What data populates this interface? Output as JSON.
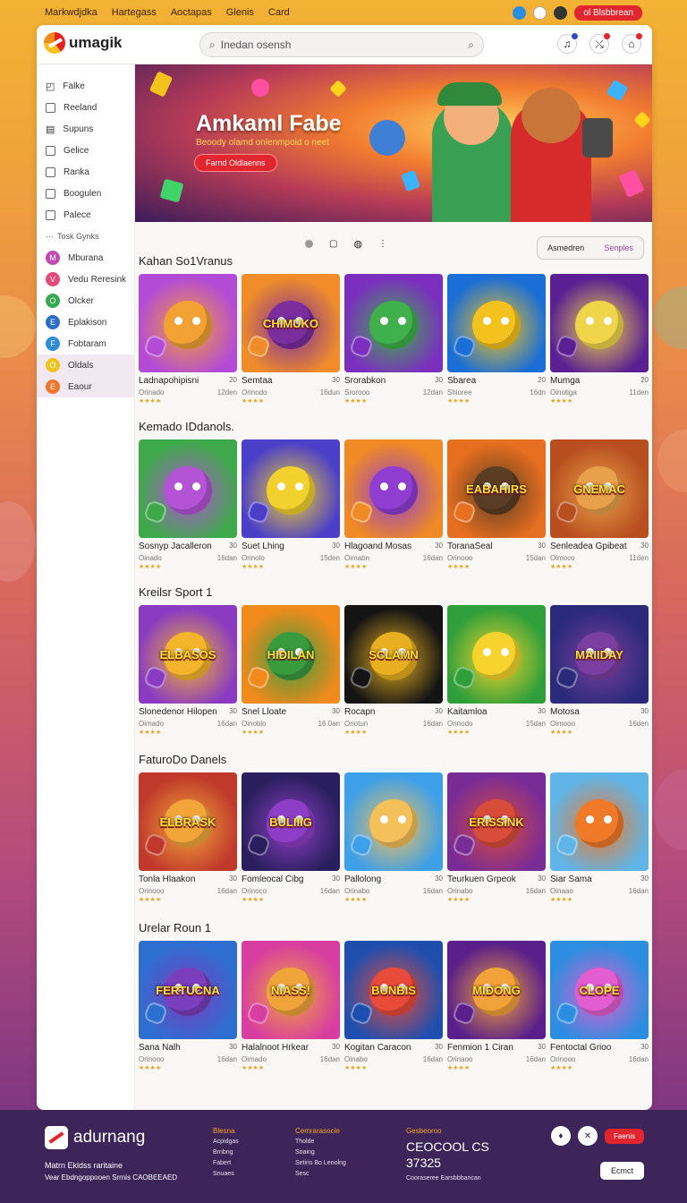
{
  "topbar": {
    "links": [
      "Markwdjdka",
      "Hartegass",
      "Aoctapas",
      "Glenis",
      "Card"
    ],
    "cta": "ol Blsbbrean"
  },
  "header": {
    "logo": "umagik",
    "search_placeholder": "Inedan osensh"
  },
  "sidebar": {
    "items": [
      "Falke",
      "Reeland",
      "Supuns",
      "Gelice",
      "Ranka",
      "Boogulen",
      "Palece"
    ],
    "section": "Tosk Gynks",
    "tags": [
      {
        "label": "Mburana",
        "color": "#c24bb3"
      },
      {
        "label": "Vedu Reresink",
        "color": "#e64a7b"
      },
      {
        "label": "Olcker",
        "color": "#35a852"
      },
      {
        "label": "Eplakison",
        "color": "#2a6ec7"
      },
      {
        "label": "Fobtaram",
        "color": "#2f8bd6"
      },
      {
        "label": "Oldals",
        "color": "#f0c21d"
      },
      {
        "label": "Eaour",
        "color": "#f07427"
      }
    ]
  },
  "hero": {
    "title": "Amkaml Fabe",
    "subtitle": "Beoody olamd onlenmpoid o neet",
    "button": "Farnd Oldlaenns"
  },
  "pager": {
    "segment": [
      "Asmedren",
      "Senples"
    ]
  },
  "sections": [
    {
      "title": "Kahan So1Vranus",
      "cards": [
        {
          "name": "Ladnapohipisni",
          "size": "20",
          "sub": "Orinado",
          "size2": "12den",
          "stars": "★★★★",
          "thumb": [
            "#b44bd6",
            "#f2a133"
          ],
          "word": ""
        },
        {
          "name": "Semtaa",
          "size": "30",
          "sub": "Orinodo",
          "size2": "16dun",
          "stars": "★★★★",
          "thumb": [
            "#f08d2a",
            "#7b2d9e"
          ],
          "word": "CHIMUKO"
        },
        {
          "name": "Srorabkon",
          "size": "30",
          "sub": "Srorooo",
          "size2": "12dan",
          "stars": "★★★★",
          "thumb": [
            "#7a2fbf",
            "#3fb04b"
          ],
          "word": ""
        },
        {
          "name": "Sbarea",
          "size": "20",
          "sub": "Shioree",
          "size2": "16dn",
          "stars": "★★★★",
          "thumb": [
            "#1b6ed6",
            "#f4c21d"
          ],
          "word": ""
        },
        {
          "name": "Mumga",
          "size": "20",
          "sub": "Oinotiga",
          "size2": "11den",
          "stars": "★★★★",
          "thumb": [
            "#5a1f93",
            "#f0d54a"
          ],
          "word": ""
        }
      ]
    },
    {
      "title": "Kemado IDdanols.",
      "cards": [
        {
          "name": "Sosnyp Jacalleron",
          "size": "30",
          "sub": "Oinado",
          "size2": "16dan",
          "stars": "★★★★",
          "thumb": [
            "#3ea94a",
            "#b453d6"
          ],
          "word": ""
        },
        {
          "name": "Suet Lhing",
          "size": "30",
          "sub": "Orinolo",
          "size2": "15den",
          "stars": "★★★★",
          "thumb": [
            "#4b3fc9",
            "#f2d12e"
          ],
          "word": ""
        },
        {
          "name": "Hlagoand Mosas",
          "size": "30",
          "sub": "Oimabn",
          "size2": "16dan",
          "stars": "★★★★",
          "thumb": [
            "#f08a24",
            "#8f3ed1"
          ],
          "word": ""
        },
        {
          "name": "ToranaSeal",
          "size": "30",
          "sub": "Orinooo",
          "size2": "15dan",
          "stars": "★★★★",
          "thumb": [
            "#e76f20",
            "#5b3d23"
          ],
          "word": "EABAHIRS"
        },
        {
          "name": "Senleadea Gpibeat",
          "size": "30",
          "sub": "Oimoco",
          "size2": "11den",
          "stars": "★★★★",
          "thumb": [
            "#b84d1e",
            "#e8a04a"
          ],
          "word": "GNEMAC"
        }
      ]
    },
    {
      "title": "Kreilsr Sport 1",
      "cards": [
        {
          "name": "Slonedenor Hilopen",
          "size": "30",
          "sub": "Oimado",
          "size2": "16dan",
          "stars": "★★★★",
          "thumb": [
            "#8a3bc2",
            "#f4b52c"
          ],
          "word": "ELBASOS"
        },
        {
          "name": "Snel Lloate",
          "size": "30",
          "sub": "Oinoblo",
          "size2": "16 0an",
          "stars": "★★★★",
          "thumb": [
            "#f08a1c",
            "#3a9b3e"
          ],
          "word": "HIDILAN"
        },
        {
          "name": "Rocapn",
          "size": "30",
          "sub": "Onotun",
          "size2": "16dan",
          "stars": "★★★★",
          "thumb": [
            "#141414",
            "#e8b020"
          ],
          "word": "SCLAMN"
        },
        {
          "name": "Kaitamloa",
          "size": "30",
          "sub": "Orinodo",
          "size2": "15dan",
          "stars": "★★★★",
          "thumb": [
            "#2e9f3a",
            "#f6d42d"
          ],
          "word": ""
        },
        {
          "name": "Motosa",
          "size": "30",
          "sub": "Oimooo",
          "size2": "16den",
          "stars": "★★★★",
          "thumb": [
            "#2b2a7a",
            "#7a3fa0"
          ],
          "word": "MAIIDAY"
        }
      ]
    },
    {
      "title": "FaturoDo Danels",
      "cards": [
        {
          "name": "Tonla Hlaakon",
          "size": "30",
          "sub": "Orinooo",
          "size2": "16dan",
          "stars": "★★★★",
          "thumb": [
            "#c0392b",
            "#f2a63a"
          ],
          "word": "ELBRASK"
        },
        {
          "name": "Fomleocal Cibg",
          "size": "30",
          "sub": "Orinoco",
          "size2": "16dan",
          "stars": "★★★★",
          "thumb": [
            "#2a1f5e",
            "#8e3ec6"
          ],
          "word": "BULIIIG"
        },
        {
          "name": "Pallolong",
          "size": "30",
          "sub": "Orinabo",
          "size2": "16dan",
          "stars": "★★★★",
          "thumb": [
            "#3da0e8",
            "#f4c05a"
          ],
          "word": ""
        },
        {
          "name": "Teurkuen Grpeok",
          "size": "30",
          "sub": "Orinabo",
          "size2": "16dan",
          "stars": "★★★★",
          "thumb": [
            "#7a2c96",
            "#d84c3a"
          ],
          "word": "ERISSINK"
        },
        {
          "name": "Siar Sama",
          "size": "30",
          "sub": "Oinaao",
          "size2": "16dan",
          "stars": "★★★★",
          "thumb": [
            "#5fb4e8",
            "#f07a28"
          ],
          "word": ""
        }
      ]
    },
    {
      "title": "Urelar Roun 1",
      "cards": [
        {
          "name": "Sana Nalh",
          "size": "30",
          "sub": "Orinooo",
          "size2": "16dan",
          "stars": "★★★★",
          "thumb": [
            "#2d6fd0",
            "#7b3ebd"
          ],
          "word": "FERTUCNA"
        },
        {
          "name": "Halalnoot Hrkear",
          "size": "30",
          "sub": "Oimado",
          "size2": "16dan",
          "stars": "★★★★",
          "thumb": [
            "#d83ea0",
            "#f0a43a"
          ],
          "word": "NIASS!"
        },
        {
          "name": "Kogitan Caracon",
          "size": "30",
          "sub": "Oinabo",
          "size2": "16dan",
          "stars": "★★★★",
          "thumb": [
            "#1f4fae",
            "#e84b3a"
          ],
          "word": "BUNBIS"
        },
        {
          "name": "Fenmion 1 Ciran",
          "size": "30",
          "sub": "Orinaoo",
          "size2": "16dan",
          "stars": "★★★★",
          "thumb": [
            "#5a1f8a",
            "#f2a23a"
          ],
          "word": "MIDONG"
        },
        {
          "name": "Fentoctal Grioo",
          "size": "30",
          "sub": "Orinooo",
          "size2": "16dan",
          "stars": "★★★★",
          "thumb": [
            "#2c8ee0",
            "#e25ed0"
          ],
          "word": "CLOPE"
        }
      ]
    }
  ],
  "footer": {
    "brand": "adurnang",
    "tag1": "Matrn Ekldss raritaine",
    "tag2": "Vear Ebdngoppooen Srrnis CAOBEEAED",
    "col1": {
      "head": "Blesna",
      "items": [
        "Acpidgas",
        "Brnbng",
        "Fabert",
        "Snuaes"
      ]
    },
    "col2": {
      "head": "Cemrarasocie",
      "items": [
        "Tholde",
        "Soaing",
        "Setiris Bo Lenolng",
        "Sesc"
      ]
    },
    "col3": {
      "head": "Gesbeoroo",
      "big1": "CEOCOOL CS",
      "big2": "37325",
      "small": "Cooraseree Earsbbbancan"
    },
    "red": "Faenis",
    "white": "Ecmct"
  }
}
